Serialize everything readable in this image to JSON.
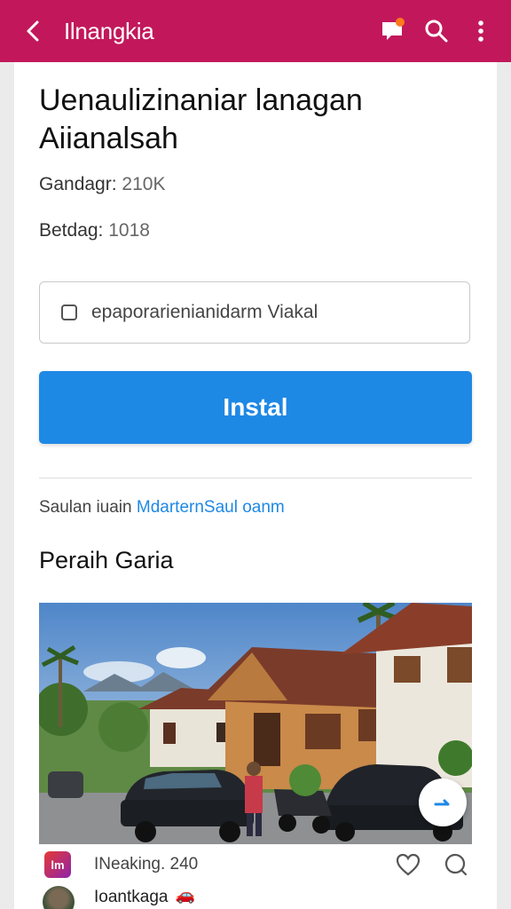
{
  "appbar": {
    "title": "Ilnangkia",
    "colors": {
      "background": "#c2185b",
      "notification_dot": "#ff7a1a"
    },
    "icons": [
      "back-arrow-icon",
      "message-icon",
      "search-icon",
      "more-vert-icon"
    ]
  },
  "app": {
    "title": "Uenaulizinaniar lanagan Aiianalsah",
    "downloads_key": "Gandagr:",
    "downloads_value": "210K",
    "size_key": "Betdag:",
    "size_value": "1018"
  },
  "consent": {
    "label": "epaporarienianidarm Viakal",
    "checked": false
  },
  "install": {
    "label": "Instal",
    "color": "#1e88e5"
  },
  "privacy": {
    "prefix": "Saulan iuain",
    "link": "MdarternSaul oanm"
  },
  "gallery": {
    "title": "Peraih Garia",
    "image_icon": "house-photo",
    "fab_icon": "expand-icon"
  },
  "post": {
    "app_icon_text": "lm",
    "meta": "INeaking. 240",
    "icons": [
      "heart-icon",
      "comment-icon"
    ]
  },
  "author": {
    "name": "Ioantkaga",
    "badge": "🚗"
  }
}
